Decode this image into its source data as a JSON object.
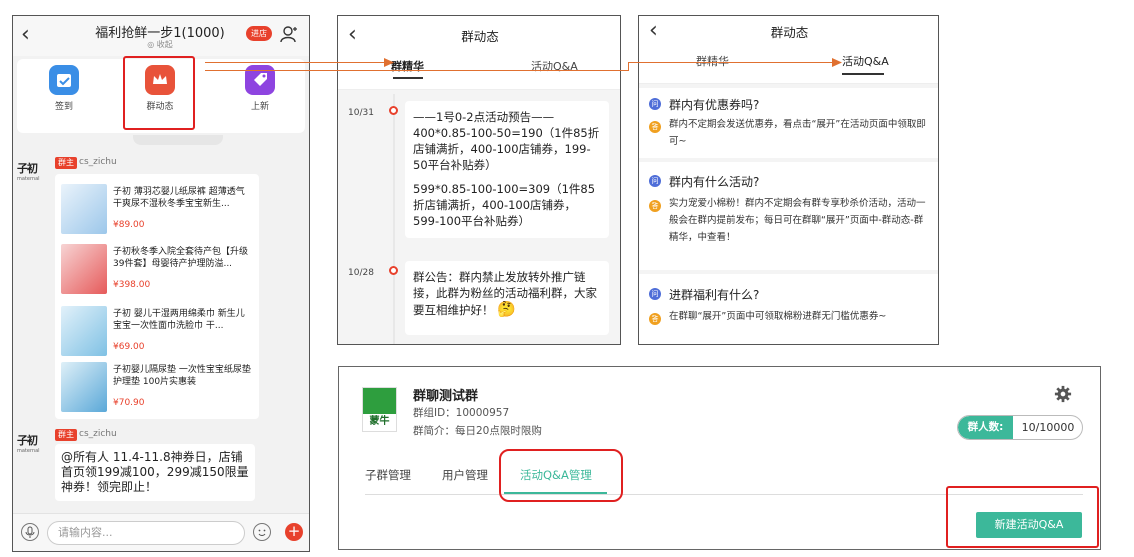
{
  "colors": {
    "accent_red": "#e8412c",
    "highlight_red": "#e02020",
    "arrow_orange": "#e07030",
    "teal": "#3cb89a",
    "qa_question_blue": "#4f6ed8",
    "qa_answer_orange": "#f0a020"
  },
  "icons": {
    "back": "‹",
    "user": "user-icon",
    "mic": "microphone-icon",
    "emoji": "emoji-icon",
    "plus": "+",
    "gear": "gear-icon"
  },
  "chat": {
    "title": "福利抢鲜一步1(1000)",
    "subtitle": "◎ 收起",
    "enter_label": "进店",
    "quick_actions": [
      {
        "label": "签到"
      },
      {
        "label": "群动态"
      },
      {
        "label": "上新"
      }
    ],
    "message1": {
      "avatar_logo": "子初",
      "avatar_sub": "maternal",
      "role": "群主",
      "username": "cs_zichu",
      "products": [
        {
          "name": "子初 薄羽芯婴儿纸尿裤 超薄透气干爽尿不湿秋冬季宝宝新生...",
          "price": "¥89.00"
        },
        {
          "name": "子初秋冬季入院全套待产包【升级39件套】母婴待产护理防溢...",
          "price": "¥398.00"
        },
        {
          "name": "子初 婴儿干湿两用绵柔巾 新生儿 宝宝一次性面巾洗脸巾 干...",
          "price": "¥69.00"
        },
        {
          "name": "子初婴儿隔尿垫 一次性宝宝纸尿垫护理垫 100片实惠装",
          "price": "¥70.90"
        }
      ]
    },
    "message2": {
      "avatar_logo": "子初",
      "avatar_sub": "maternal",
      "role": "群主",
      "username": "cs_zichu",
      "text": "@所有人 11.4-11.8神券日，店铺首页领199减100，299减150限量神券！领完即止！"
    },
    "input_placeholder": "请输内容..."
  },
  "dynamics": {
    "title": "群动态",
    "tabs": [
      "群精华",
      "活动Q&A"
    ],
    "active_tab": "群精华",
    "entries": [
      {
        "date": "10/31",
        "paragraph1": "——1号0-2点活动预告——400*0.85-100-50=190（1件85折店铺满折，400-100店铺券，199-50平台补贴券）",
        "paragraph2": "599*0.85-100-100=309（1件85折店铺满折，400-100店铺券，599-100平台补贴券）"
      },
      {
        "date": "10/28",
        "paragraph1": "群公告：群内禁止发放转外推广链接，此群为粉丝的活动福利群，大家要互相维护好！",
        "emoji": "🤔"
      }
    ]
  },
  "qa": {
    "title": "群动态",
    "tabs": [
      "群精华",
      "活动Q&A"
    ],
    "active_tab": "活动Q&A",
    "q_icon": "问",
    "a_icon": "答",
    "items": [
      {
        "question": "群内有优惠券吗?",
        "answer": "群内不定期会发送优惠券，看点击“展开”在活动页面中领取即可~"
      },
      {
        "question": "群内有什么活动?",
        "answer": "实力宠爱小棉粉！群内不定期会有群专享秒杀价活动，活动一般会在群内提前发布；每日可在群聊“展开”页面中-群动态-群精华，中查看！"
      },
      {
        "question": "进群福利有什么?",
        "answer": "在群聊“展开”页面中可领取棉粉进群无门槛优惠券~"
      }
    ]
  },
  "admin": {
    "logo_text": "蒙牛",
    "group_name": "群聊测试群",
    "group_id_line": "群组ID：10000957",
    "group_intro_line": "群简介：每日20点限时限购",
    "count_label": "群人数:",
    "count_value": "10/10000",
    "tabs": [
      "子群管理",
      "用户管理",
      "活动Q&A管理"
    ],
    "active_tab": "活动Q&A管理",
    "new_button": "新建活动Q&A"
  }
}
